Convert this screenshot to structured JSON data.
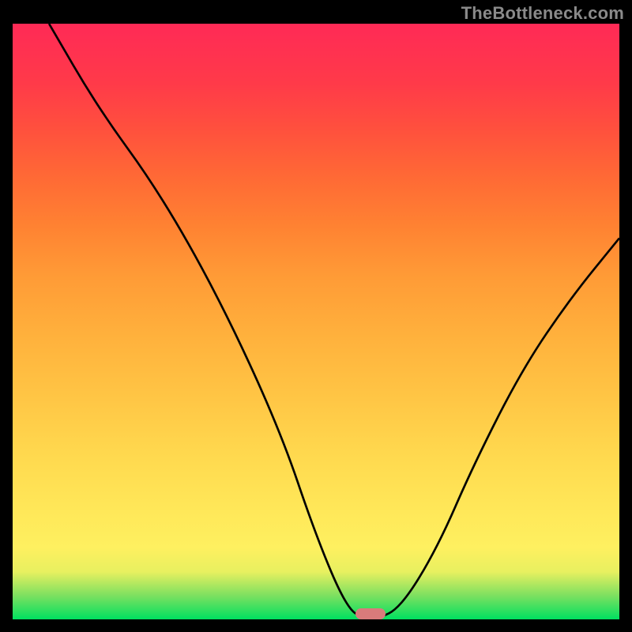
{
  "watermark": "TheBottleneck.com",
  "chart_data": {
    "type": "line",
    "title": "",
    "xlabel": "",
    "ylabel": "",
    "xlim": [
      0,
      100
    ],
    "ylim": [
      0,
      100
    ],
    "grid": false,
    "legend": false,
    "series": [
      {
        "name": "bottleneck-curve",
        "x": [
          6,
          14,
          24,
          34,
          44,
          50,
          55,
          58,
          60,
          64,
          70,
          76,
          84,
          92,
          100
        ],
        "y": [
          100,
          86,
          72,
          54,
          32,
          14,
          2,
          0,
          0,
          2,
          12,
          26,
          42,
          54,
          64
        ]
      }
    ],
    "marker": {
      "name": "optimal-range",
      "x_center": 59,
      "width_pct": 5,
      "color": "#d97b7b"
    },
    "gradient_stops": [
      {
        "pos": 0,
        "color": "#00e060"
      },
      {
        "pos": 12,
        "color": "#fef060"
      },
      {
        "pos": 50,
        "color": "#ffb03c"
      },
      {
        "pos": 100,
        "color": "#ff2a56"
      }
    ]
  }
}
